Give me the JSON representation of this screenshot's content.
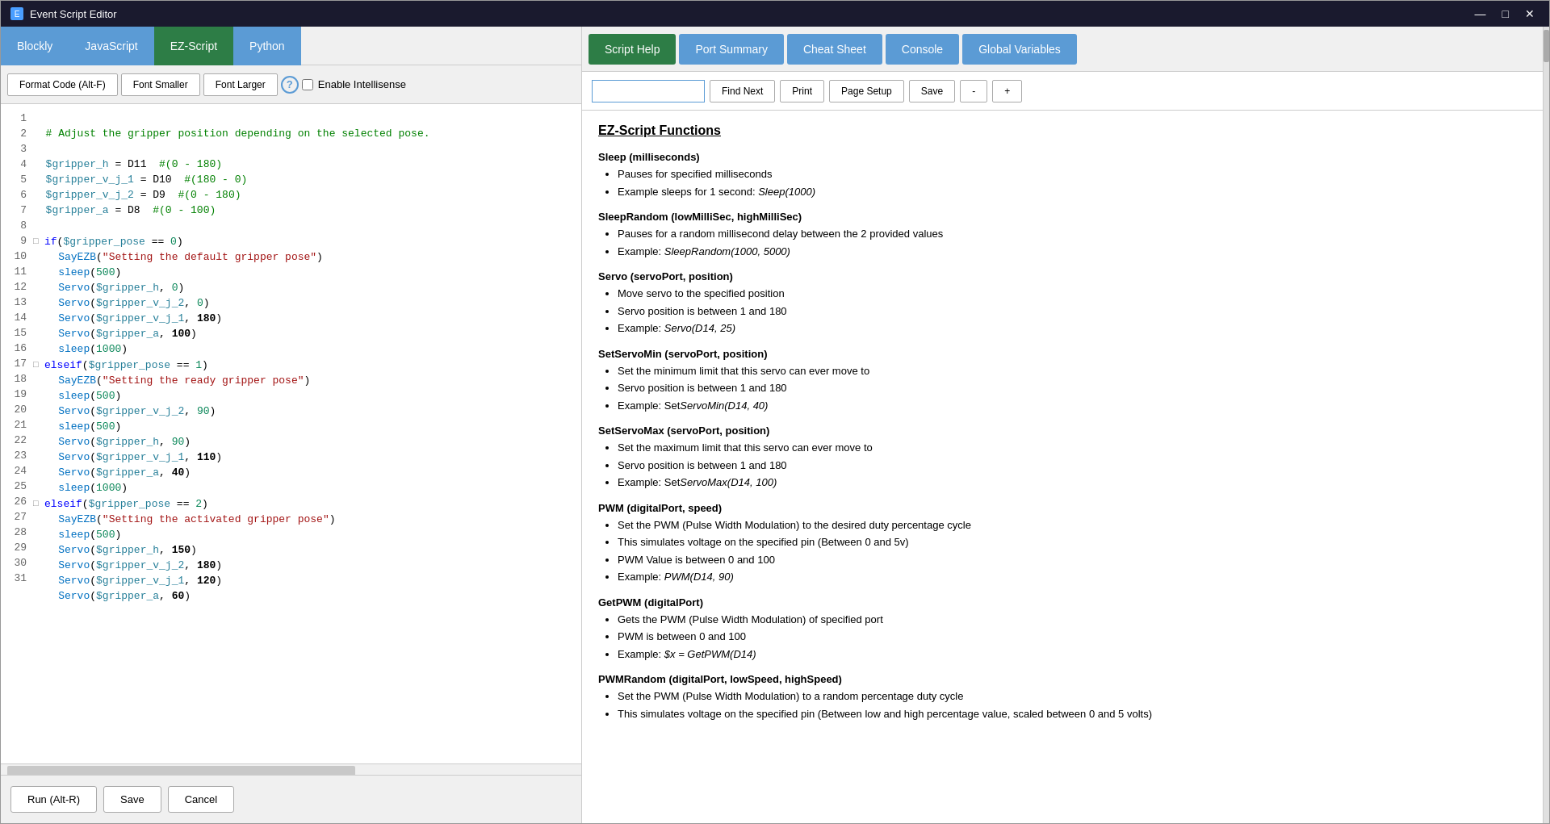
{
  "window": {
    "title": "Event Script Editor"
  },
  "lang_tabs": [
    {
      "label": "Blockly",
      "class": "blockly"
    },
    {
      "label": "JavaScript",
      "class": "javascript"
    },
    {
      "label": "EZ-Script",
      "class": "ez-script",
      "active": true
    },
    {
      "label": "Python",
      "class": "python"
    }
  ],
  "toolbar": {
    "format_code": "Format Code (Alt-F)",
    "font_smaller": "Font Smaller",
    "font_larger": "Font Larger",
    "intellisense_label": "Enable Intellisense"
  },
  "script_tabs": [
    {
      "label": "Script Help",
      "active": true
    },
    {
      "label": "Port Summary"
    },
    {
      "label": "Cheat Sheet"
    },
    {
      "label": "Console"
    },
    {
      "label": "Global Variables"
    }
  ],
  "search": {
    "placeholder": "",
    "find_next": "Find Next",
    "print": "Print",
    "page_setup": "Page Setup",
    "save": "Save",
    "minus": "-",
    "plus": "+"
  },
  "help": {
    "title": "EZ-Script Functions",
    "functions": [
      {
        "name": "Sleep (milliseconds)",
        "bullets": [
          "Pauses for specified milliseconds",
          "Example sleeps for 1 second: Sleep(1000)"
        ],
        "italic_idx": [
          1
        ]
      },
      {
        "name": "SleepRandom (lowMilliSec, highMilliSec)",
        "bullets": [
          "Pauses for a random millisecond delay between the 2 provided values",
          "Example: SleepRandom(1000, 5000)"
        ],
        "italic_idx": [
          1
        ]
      },
      {
        "name": "Servo (servoPort, position)",
        "bullets": [
          "Move servo to the specified position",
          "Servo position is between 1 and 180",
          "Example: Servo(D14, 25)"
        ],
        "italic_idx": [
          2
        ]
      },
      {
        "name": "SetServoMin (servoPort, position)",
        "bullets": [
          "Set the minimum limit that this servo can ever move to",
          "Servo position is between 1 and 180",
          "Example: SetServoMin(D14, 40)"
        ],
        "italic_idx": [
          2
        ]
      },
      {
        "name": "SetServoMax (servoPort, position)",
        "bullets": [
          "Set the maximum limit that this servo can ever move to",
          "Servo position is between 1 and 180",
          "Example: SetServoMax(D14, 100)"
        ],
        "italic_idx": [
          2
        ]
      },
      {
        "name": "PWM (digitalPort, speed)",
        "bullets": [
          "Set the PWM (Pulse Width Modulation) to the desired duty percentage cycle",
          "This simulates voltage on the specified pin (Between 0 and 5v)",
          "PWM Value is between 0 and 100",
          "Example: PWM(D14, 90)"
        ],
        "italic_idx": [
          3
        ]
      },
      {
        "name": "GetPWM (digitalPort)",
        "bullets": [
          "Gets the PWM (Pulse Width Modulation) of specified port",
          "PWM is between 0 and 100",
          "Example: $x = GetPWM(D14)"
        ],
        "italic_idx": [
          2
        ]
      },
      {
        "name": "PWMRandom (digitalPort, lowSpeed, highSpeed)",
        "bullets": [
          "Set the PWM (Pulse Width Modulation) to a random percentage duty cycle",
          "This simulates voltage on the specified pin (Between low and high percentage value, scaled between 0 and 5 volts)"
        ],
        "italic_idx": []
      }
    ]
  },
  "bottom": {
    "run": "Run (Alt-R)",
    "save": "Save",
    "cancel": "Cancel"
  },
  "code_lines": [
    {
      "num": 1,
      "text": "  # Adjust the gripper position depending on the selected pose.",
      "type": "comment"
    },
    {
      "num": 2,
      "text": "",
      "type": "blank"
    },
    {
      "num": 3,
      "text": "  $gripper_h = D11  #(0 - 180)",
      "type": "var"
    },
    {
      "num": 4,
      "text": "  $gripper_v_j_1 = D10  #(180 - 0)",
      "type": "var"
    },
    {
      "num": 5,
      "text": "  $gripper_v_j_2 = D9  #(0 - 180)",
      "type": "var"
    },
    {
      "num": 6,
      "text": "  $gripper_a = D8  #(0 - 100)",
      "type": "var"
    },
    {
      "num": 7,
      "text": "",
      "type": "blank"
    },
    {
      "num": 8,
      "text": "if($gripper_pose == 0)",
      "type": "if",
      "fold": true
    },
    {
      "num": 9,
      "text": "    SayEZB(\"Setting the default gripper pose\")",
      "type": "func"
    },
    {
      "num": 10,
      "text": "    sleep(500)",
      "type": "func"
    },
    {
      "num": 11,
      "text": "    Servo($gripper_h, 0)",
      "type": "func"
    },
    {
      "num": 12,
      "text": "    Servo($gripper_v_j_2, 0)",
      "type": "func"
    },
    {
      "num": 13,
      "text": "    Servo($gripper_v_j_1, 180)",
      "type": "func"
    },
    {
      "num": 14,
      "text": "    Servo($gripper_a, 100)",
      "type": "func"
    },
    {
      "num": 15,
      "text": "    sleep(1000)",
      "type": "func"
    },
    {
      "num": 16,
      "text": "elseif($gripper_pose == 1)",
      "type": "elseif",
      "fold": true
    },
    {
      "num": 17,
      "text": "    SayEZB(\"Setting the ready gripper pose\")",
      "type": "func"
    },
    {
      "num": 18,
      "text": "    sleep(500)",
      "type": "func"
    },
    {
      "num": 19,
      "text": "    Servo($gripper_v_j_2, 90)",
      "type": "func"
    },
    {
      "num": 20,
      "text": "    sleep(500)",
      "type": "func"
    },
    {
      "num": 21,
      "text": "    Servo($gripper_h, 90)",
      "type": "func"
    },
    {
      "num": 22,
      "text": "    Servo($gripper_v_j_1, 110)",
      "type": "func"
    },
    {
      "num": 23,
      "text": "    Servo($gripper_a, 40)",
      "type": "func"
    },
    {
      "num": 24,
      "text": "    sleep(1000)",
      "type": "func"
    },
    {
      "num": 25,
      "text": "elseif($gripper_pose == 2)",
      "type": "elseif",
      "fold": true
    },
    {
      "num": 26,
      "text": "    SayEZB(\"Setting the activated gripper pose\")",
      "type": "func"
    },
    {
      "num": 27,
      "text": "    sleep(500)",
      "type": "func"
    },
    {
      "num": 28,
      "text": "    Servo($gripper_h, 150)",
      "type": "func"
    },
    {
      "num": 29,
      "text": "    Servo($gripper_v_j_2, 180)",
      "type": "func"
    },
    {
      "num": 30,
      "text": "    Servo($gripper_v_j_1, 120)",
      "type": "func"
    },
    {
      "num": 31,
      "text": "    Servo($gripper_a, 60)",
      "type": "func"
    }
  ]
}
